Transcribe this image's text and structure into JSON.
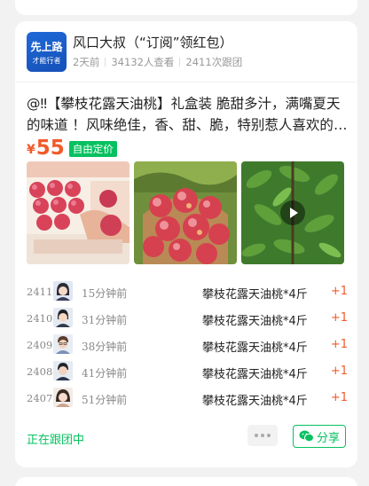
{
  "post": {
    "author_name": "风口大叔（“订阅”领红包）",
    "logo_text_main": "先上路",
    "logo_text_sub": "才能行者",
    "posted": "2天前",
    "views": "34132人查看",
    "followers": "2411次跟团",
    "description": "@‼【攀枝花露天油桃】礼盒装 脆甜多汁，满嘴夏天的味道 ！风味绝佳，香、甜、脆，特别惹人喜欢的攀枝花露天油桃",
    "currency": "¥",
    "price": "55",
    "price_tag": "自由定价",
    "images": [
      "peach-gift-box-photo",
      "peach-basket-photo",
      "peach-orchard-video"
    ]
  },
  "orders": [
    {
      "index": "2411",
      "time": "15分钟前",
      "item": "攀枝花露天油桃*4斤",
      "qty": "+1",
      "avatar": "avatar-girl-dark-hair"
    },
    {
      "index": "2410",
      "time": "31分钟前",
      "item": "攀枝花露天油桃*4斤",
      "qty": "+1",
      "avatar": "avatar-girl-ponytail"
    },
    {
      "index": "2409",
      "time": "38分钟前",
      "item": "攀枝花露天油桃*4斤",
      "qty": "+1",
      "avatar": "avatar-boy-glasses"
    },
    {
      "index": "2408",
      "time": "41分钟前",
      "item": "攀枝花露天油桃*4斤",
      "qty": "+1",
      "avatar": "avatar-boy-shirt"
    },
    {
      "index": "2407",
      "time": "51分钟前",
      "item": "攀枝花露天油桃*4斤",
      "qty": "+1",
      "avatar": "avatar-girl-long-hair"
    }
  ],
  "footer": {
    "status": "正在跟团中",
    "share_label": "分享"
  },
  "colors": {
    "accent_green": "#07c160",
    "price_orange": "#f25a2a",
    "logo_blue": "#1f6ad8"
  }
}
